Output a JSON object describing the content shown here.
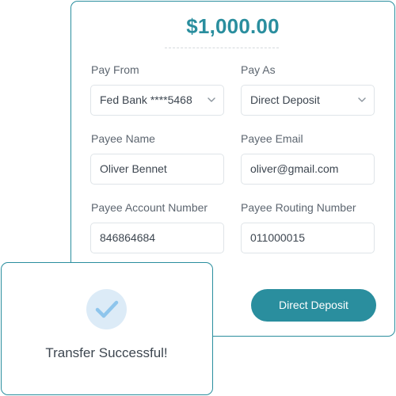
{
  "payment": {
    "amount": "$1,000.00",
    "pay_from": {
      "label": "Pay From",
      "value": "Fed Bank ****5468"
    },
    "pay_as": {
      "label": "Pay As",
      "value": "Direct Deposit"
    },
    "payee_name": {
      "label": "Payee Name",
      "value": "Oliver Bennet"
    },
    "payee_email": {
      "label": "Payee Email",
      "value": "oliver@gmail.com"
    },
    "payee_account": {
      "label": "Payee Account Number",
      "value": "846864684"
    },
    "payee_routing": {
      "label": "Payee Routing Number",
      "value": "011000015"
    },
    "submit_label": "Direct Deposit"
  },
  "success": {
    "message": "Transfer Successful!",
    "icon": "checkmark-icon"
  },
  "colors": {
    "accent": "#2a8e9e",
    "check_bg": "#dcebf7",
    "check_mark": "#8ec5ec"
  }
}
